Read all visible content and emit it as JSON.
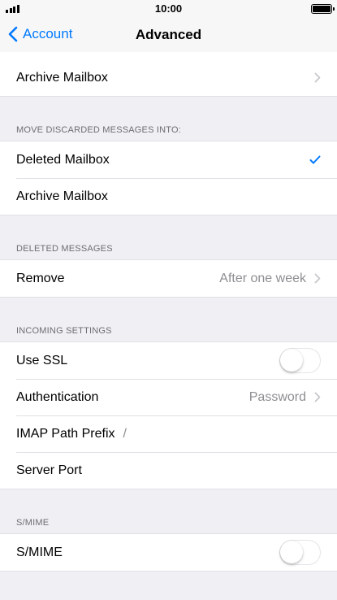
{
  "status_bar": {
    "time": "10:00"
  },
  "nav": {
    "back_label": "Account",
    "title": "Advanced"
  },
  "top_group": {
    "archive_mailbox": "Archive Mailbox"
  },
  "move_discarded": {
    "header": "MOVE DISCARDED MESSAGES INTO:",
    "deleted_mailbox": "Deleted Mailbox",
    "archive_mailbox": "Archive Mailbox",
    "selected": "Deleted Mailbox"
  },
  "deleted_messages": {
    "header": "DELETED MESSAGES",
    "remove_label": "Remove",
    "remove_value": "After one week"
  },
  "incoming": {
    "header": "INCOMING SETTINGS",
    "use_ssl_label": "Use SSL",
    "use_ssl_on": false,
    "auth_label": "Authentication",
    "auth_value": "Password",
    "imap_label": "IMAP Path Prefix",
    "imap_value": "/",
    "port_label": "Server Port"
  },
  "smime": {
    "header": "S/MIME",
    "label": "S/MIME",
    "on": false
  },
  "colors": {
    "accent": "#007aff",
    "background": "#efeff4",
    "secondary_text": "#8e8e93"
  }
}
